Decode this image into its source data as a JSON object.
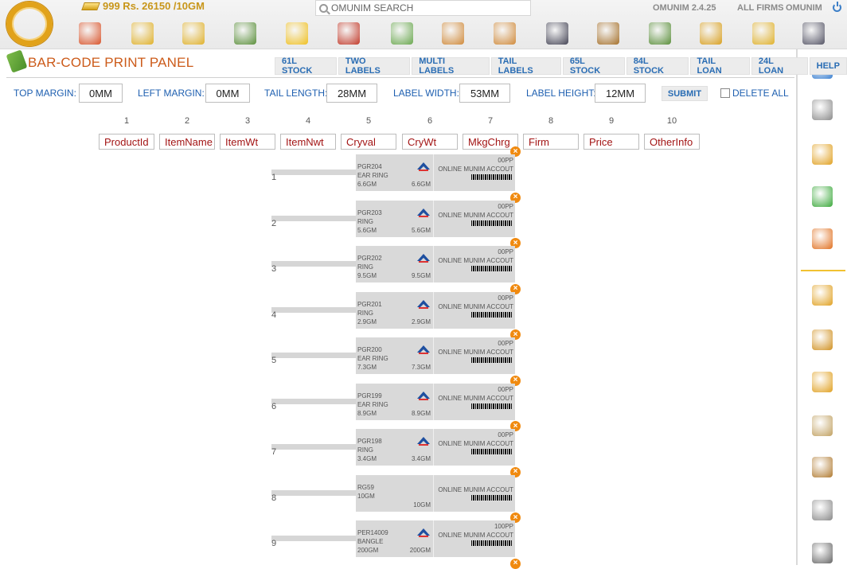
{
  "header": {
    "gold_rate": "999 Rs. 26150 /10GM",
    "search_placeholder": "OMUNIM SEARCH",
    "version": "OMUNIM 2.4.25",
    "all_firms": "ALL FIRMS",
    "user": "OMUNIM"
  },
  "nav_icons": [
    "home-icon",
    "add-gold-icon",
    "gold-coins-icon",
    "payment-icon",
    "new-badge-icon",
    "hammer-icon",
    "money-icon",
    "user-icon",
    "add-user-icon",
    "agent-icon",
    "money-bag-icon",
    "cash-stack-icon",
    "coins-hand-icon",
    "stock-chart-icon",
    "calculator-icon"
  ],
  "panel": {
    "title": "BAR-CODE PRINT PANEL",
    "tabs": [
      "61L STOCK",
      "TWO LABELS",
      "MULTI LABELS",
      "TAIL LABELS",
      "65L STOCK",
      "84L STOCK",
      "TAIL LOAN",
      "24L LOAN",
      "HELP"
    ]
  },
  "settings": {
    "top_margin_label": "TOP MARGIN:",
    "top_margin": "0MM",
    "left_margin_label": "LEFT MARGIN:",
    "left_margin": "0MM",
    "tail_length_label": "TAIL LENGTH:",
    "tail_length": "28MM",
    "label_width_label": "LABEL WIDTH:",
    "label_width": "53MM",
    "label_height_label": "LABEL HEIGHT:",
    "label_height": "12MM",
    "submit_label": "SUBMIT",
    "delete_all_label": "DELETE ALL"
  },
  "columns": {
    "numbers": [
      "1",
      "2",
      "3",
      "4",
      "5",
      "6",
      "7",
      "8",
      "9",
      "10"
    ],
    "fields": [
      "ProductId",
      "ItemName",
      "ItemWt",
      "ItemNwt",
      "Cryval",
      "CryWt",
      "MkgChrg",
      "Firm",
      "Price",
      "OtherInfo"
    ]
  },
  "labels": [
    {
      "num": "1",
      "id": "PGR204",
      "name": "EAR RING",
      "gwt": "6.6GM",
      "nwt": "6.6GM",
      "purity": "00PP",
      "firm": "ONLINE MUNIM ACCOUT",
      "barcode": true
    },
    {
      "num": "2",
      "id": "PGR203",
      "name": "RING",
      "gwt": "5.6GM",
      "nwt": "5.6GM",
      "purity": "00PP",
      "firm": "ONLINE MUNIM ACCOUT",
      "barcode": true
    },
    {
      "num": "3",
      "id": "PGR202",
      "name": "RING",
      "gwt": "9.5GM",
      "nwt": "9.5GM",
      "purity": "00PP",
      "firm": "ONLINE MUNIM ACCOUT",
      "barcode": true
    },
    {
      "num": "4",
      "id": "PGR201",
      "name": "RING",
      "gwt": "2.9GM",
      "nwt": "2.9GM",
      "purity": "00PP",
      "firm": "ONLINE MUNIM ACCOUT",
      "barcode": true
    },
    {
      "num": "5",
      "id": "PGR200",
      "name": "EAR RING",
      "gwt": "7.3GM",
      "nwt": "7.3GM",
      "purity": "00PP",
      "firm": "ONLINE MUNIM ACCOUT",
      "barcode": true
    },
    {
      "num": "6",
      "id": "PGR199",
      "name": "EAR RING",
      "gwt": "8.9GM",
      "nwt": "8.9GM",
      "purity": "00PP",
      "firm": "ONLINE MUNIM ACCOUT",
      "barcode": true
    },
    {
      "num": "7",
      "id": "PGR198",
      "name": "RING",
      "gwt": "3.4GM",
      "nwt": "3.4GM",
      "purity": "00PP",
      "firm": "ONLINE MUNIM ACCOUT",
      "barcode": true
    },
    {
      "num": "8",
      "id": "RG59",
      "name": "10GM",
      "gwt": "",
      "nwt": "10GM",
      "purity": "",
      "firm": "ONLINE MUNIM ACCOUT",
      "barcode": true,
      "no_logo": true
    },
    {
      "num": "9",
      "id": "PER14009",
      "name": "BANGLE",
      "gwt": "200GM",
      "nwt": "200GM",
      "purity": "100PP",
      "firm": "ONLINE MUNIM ACCOUT",
      "barcode": true
    }
  ],
  "sidebar_icons": [
    "bar-chart-icon",
    "settings-gear-icon",
    "hierarchy-icon",
    "sms-icon",
    "calendar-icon",
    "ledger-icon",
    "notebook-icon",
    "stats-icon",
    "people-icon",
    "scale-icon",
    "stopwatch-icon",
    "calculator-icon"
  ],
  "colors": {
    "accent_blue": "#1e5fb0",
    "title_orange": "#cc5b1a",
    "field_red": "#a31515",
    "gold": "#c8961a"
  }
}
